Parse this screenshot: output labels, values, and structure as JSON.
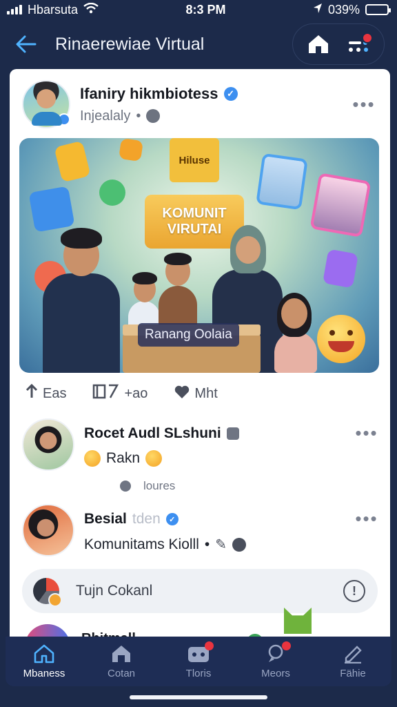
{
  "status_bar": {
    "carrier": "Hbarsuta",
    "time": "8:3 PM",
    "battery": "039%",
    "battery_level": 0.39
  },
  "header": {
    "title": "Rinaerewiae Virtual",
    "back_icon": "arrow-left-icon",
    "actions": [
      "home-icon",
      "settings-icon"
    ]
  },
  "post": {
    "author": "Ifaniry hikmbiotess",
    "subtitle": "Injealaly",
    "image": {
      "headline_line1": "KOMUNIT",
      "headline_line2": "VIRUTAI",
      "sign": "Hiluse",
      "label": "Ranang Oolaia"
    },
    "actions": [
      {
        "icon": "share-icon",
        "label": "Eas"
      },
      {
        "icon": "bookmark-icon",
        "label": "+ao"
      },
      {
        "icon": "heart-icon",
        "label": "Mht"
      }
    ]
  },
  "comments": [
    {
      "name": "Rocet Audl SLshuni",
      "text": "Rakn"
    },
    {
      "name": "Besial",
      "name_faded": "tden",
      "text": "Komunitams Kiolll"
    }
  ],
  "replies_label": "loures",
  "compose": {
    "placeholder": "Tujn Cokanl"
  },
  "peek": {
    "name": "Rhitmall"
  },
  "bottom_nav": [
    {
      "label": "Mbaness",
      "icon": "home-icon",
      "active": true
    },
    {
      "label": "Cotan",
      "icon": "community-icon",
      "active": false
    },
    {
      "label": "Tloris",
      "icon": "chat-icon",
      "active": false
    },
    {
      "label": "Meors",
      "icon": "location-icon",
      "active": false
    },
    {
      "label": "Fähie",
      "icon": "edit-icon",
      "active": false
    }
  ],
  "colors": {
    "background": "#1c2a4a",
    "accent": "#4fb3ff",
    "verified": "#3d8ff0",
    "notification": "#e9343f"
  }
}
